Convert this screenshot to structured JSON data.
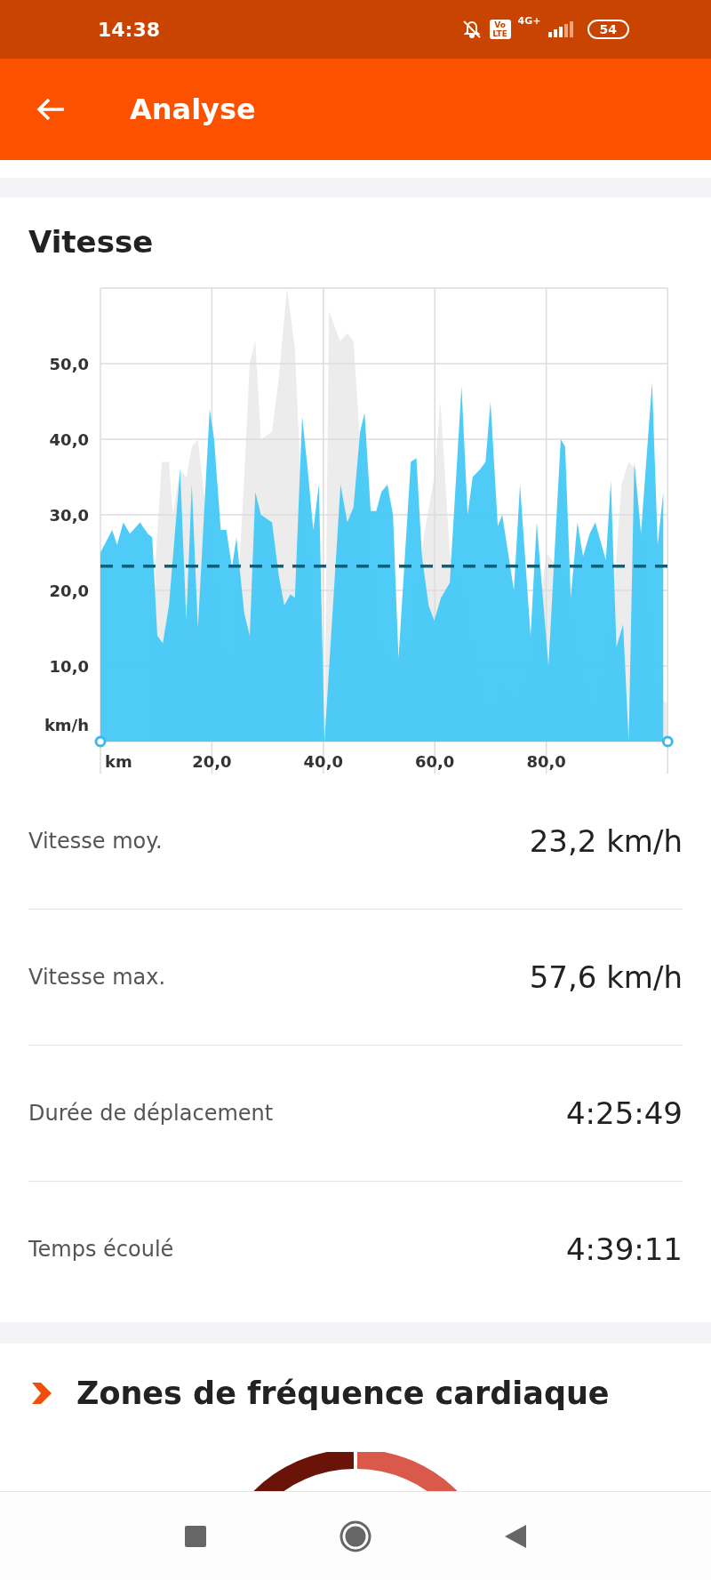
{
  "status_bar": {
    "time": "14:38",
    "volte": "Vo LTE",
    "network": "4G+",
    "battery": "54"
  },
  "app_bar": {
    "title": "Analyse"
  },
  "speed_card": {
    "title": "Vitesse",
    "chart_data": {
      "type": "area",
      "xlim": [
        0,
        101.8
      ],
      "ylim": [
        0,
        60
      ],
      "xlabel": "km",
      "ylabel": "km/h",
      "xticks": [
        {
          "value": 20,
          "label": "20,0"
        },
        {
          "value": 40,
          "label": "40,0"
        },
        {
          "value": 60,
          "label": "60,0"
        },
        {
          "value": 80,
          "label": "80,0"
        }
      ],
      "yticks": [
        {
          "value": 10,
          "label": "10,0"
        },
        {
          "value": 20,
          "label": "20,0"
        },
        {
          "value": 30,
          "label": "30,0"
        },
        {
          "value": 40,
          "label": "40,0"
        },
        {
          "value": 50,
          "label": "50,0"
        }
      ],
      "x": [
        0,
        2.1,
        3.0,
        4.1,
        5.3,
        7.1,
        8.5,
        9.3,
        10.2,
        11.2,
        12.3,
        14.3,
        15.4,
        16.4,
        17.5,
        19.6,
        20.4,
        21.6,
        22.6,
        23.6,
        24.4,
        25.8,
        26.8,
        27.8,
        28.8,
        30.8,
        32.0,
        33.0,
        34.1,
        34.9,
        36.2,
        37.2,
        38.2,
        39.2,
        40.2,
        43.1,
        44.3,
        45.4,
        46.6,
        47.4,
        48.5,
        49.5,
        50.4,
        51.5,
        52.5,
        53.5,
        55.7,
        56.7,
        57.7,
        58.9,
        59.9,
        61.1,
        62.7,
        64.8,
        65.9,
        66.8,
        68.1,
        69.1,
        70.0,
        71.3,
        72.1,
        74.2,
        75.3,
        77.2,
        78.3,
        80.4,
        82.6,
        83.4,
        84.4,
        85.6,
        86.6,
        87.8,
        88.8,
        90.7,
        91.6,
        92.6,
        93.8,
        94.8,
        95.8,
        97.0,
        99.0,
        100.0,
        101.0
      ],
      "series": [
        {
          "color": "#45c9f7",
          "values": [
            25,
            28,
            26,
            29,
            27.5,
            29,
            27.5,
            27,
            14,
            13,
            18,
            36,
            16,
            34,
            15,
            44,
            40,
            28,
            28,
            23,
            27,
            17,
            14,
            33,
            30,
            29,
            22,
            18,
            19.5,
            19,
            43,
            36,
            28,
            34,
            0,
            34,
            29,
            31,
            41,
            43.5,
            30.5,
            30.5,
            33,
            34,
            30,
            11,
            37,
            37.5,
            24.5,
            18,
            16,
            19,
            21,
            47,
            30,
            35,
            36,
            37,
            45,
            28.5,
            30,
            20,
            34,
            14,
            29,
            10,
            40,
            39,
            19,
            29,
            24.5,
            27.5,
            29,
            24,
            34.5,
            12.5,
            15.5,
            0,
            37,
            27.5,
            47.5,
            26,
            33
          ]
        }
      ],
      "grid": true
    },
    "stats": [
      {
        "label": "Vitesse moy.",
        "value": "23,2 km/h"
      },
      {
        "label": "Vitesse max.",
        "value": "57,6 km/h"
      },
      {
        "label": "Durée de déplacement",
        "value": "4:25:49"
      },
      {
        "label": "Temps écoulé",
        "value": "4:39:11"
      }
    ]
  },
  "hr_card": {
    "title": "Zones de fréquence cardiaque"
  }
}
